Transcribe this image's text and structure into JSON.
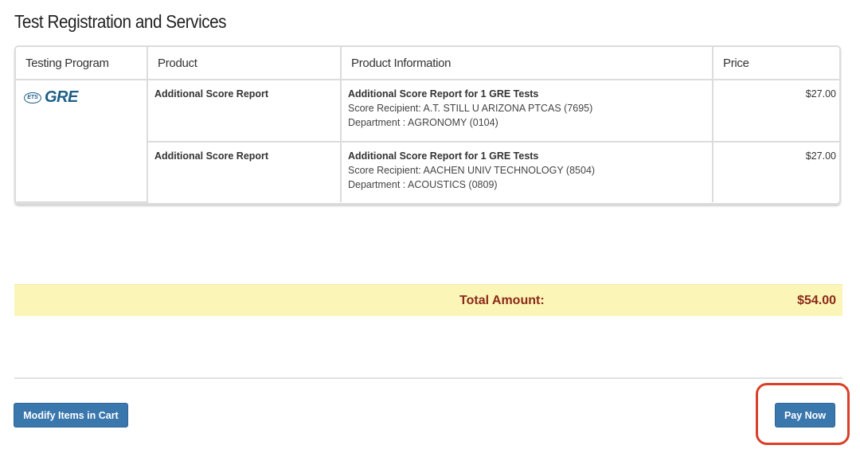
{
  "page": {
    "title": "Test Registration and Services"
  },
  "table": {
    "headers": {
      "testing_program": "Testing Program",
      "product": "Product",
      "product_information": "Product Information",
      "price": "Price"
    },
    "program": {
      "logo_mark": "ETS",
      "logo_text": "GRE"
    },
    "rows": [
      {
        "product": "Additional Score Report",
        "info_title": "Additional Score Report for 1 GRE Tests",
        "recipient": "Score Recipient: A.T. STILL U ARIZONA PTCAS (7695)",
        "department": "Department : AGRONOMY (0104)",
        "price": "$27.00"
      },
      {
        "product": "Additional Score Report",
        "info_title": "Additional Score Report for 1 GRE Tests",
        "recipient": "Score Recipient: AACHEN UNIV TECHNOLOGY (8504)",
        "department": "Department : ACOUSTICS (0809)",
        "price": "$27.00"
      }
    ]
  },
  "total": {
    "label": "Total Amount:",
    "value": "$54.00"
  },
  "buttons": {
    "modify_label": "Modify Items in Cart",
    "pay_label": "Pay Now"
  },
  "colors": {
    "button_blue": "#3a77ad",
    "total_bar": "#fbf6b8",
    "total_text": "#8b2a18",
    "highlight_ring": "#d8402a",
    "logo_blue": "#1d5f86"
  }
}
